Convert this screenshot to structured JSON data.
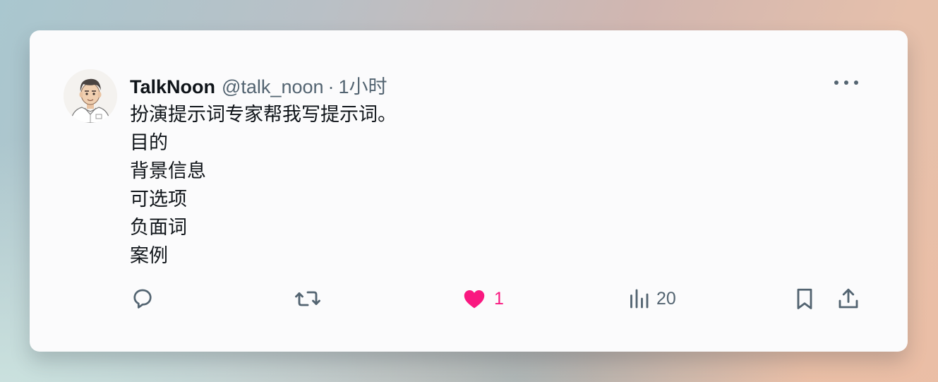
{
  "tweet": {
    "author_name": "TalkNoon",
    "handle": "@talk_noon",
    "separator": "·",
    "time": "1小时",
    "lines": [
      "扮演提示词专家帮我写提示词。",
      "目的",
      "背景信息",
      "可选项",
      "负面词",
      "案例"
    ]
  },
  "actions": {
    "reply_icon": "reply-icon",
    "retweet_icon": "retweet-icon",
    "like_icon": "heart-filled-icon",
    "like_count": "1",
    "views_icon": "views-chart-icon",
    "views_count": "20",
    "bookmark_icon": "bookmark-icon",
    "share_icon": "share-icon"
  },
  "colors": {
    "like_active": "#f91880",
    "text_primary": "#0f1419",
    "text_secondary": "#536471",
    "card_background": "#fbfbfc"
  }
}
